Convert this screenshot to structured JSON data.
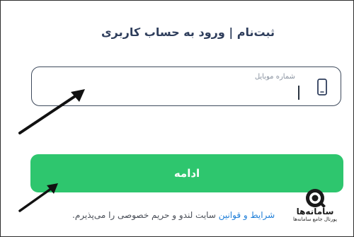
{
  "page": {
    "title": "ثبت‌نام | ورود به حساب کاربری"
  },
  "phone_field": {
    "label": "شماره موبایل",
    "value": "",
    "icon": "mobile-phone-icon"
  },
  "continue_button": {
    "label": "ادامه",
    "color": "#2ec66e"
  },
  "terms": {
    "link_text": "شرایط و قوانین",
    "rest_text": " سایت لندو و حریم خصوصی را می‌پذیرم."
  },
  "watermark": {
    "name": "سامانه‌ها",
    "subtitle": "پورتال جامع سامانه‌ها"
  },
  "colors": {
    "title": "#2f3e5c",
    "link": "#1e7ed8",
    "field_border": "#3e4a5c"
  }
}
